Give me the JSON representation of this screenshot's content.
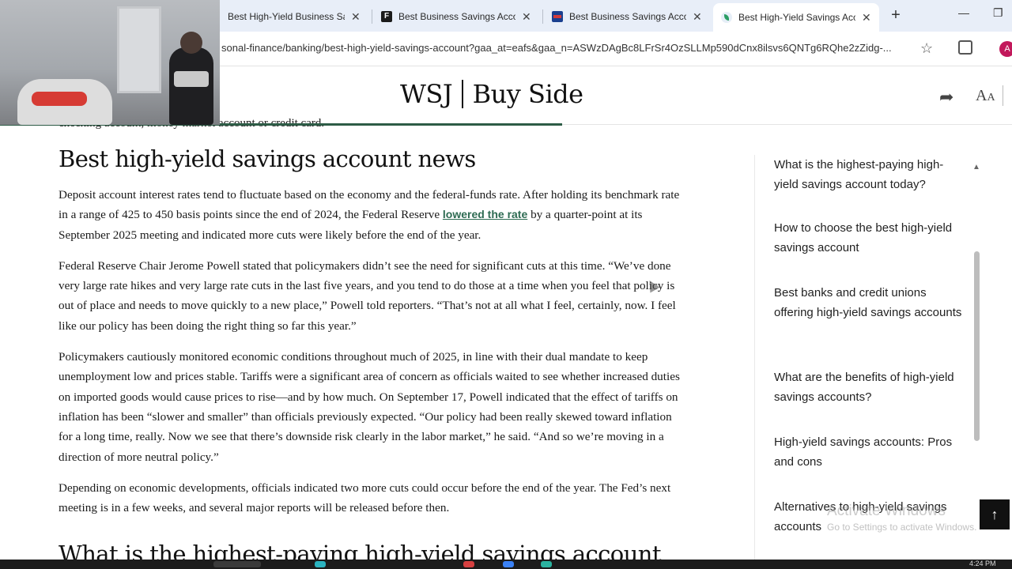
{
  "browser": {
    "tabs": [
      {
        "title": "Best High-Yield Business Sa",
        "favicon": "none",
        "active": false
      },
      {
        "title": "Best Business Savings Acco",
        "favicon": "forbes-f-icon",
        "active": false
      },
      {
        "title": "Best Business Savings Acco",
        "favicon": "usnews-icon",
        "active": false
      },
      {
        "title": "Best High-Yield Savings Acc",
        "favicon": "buyside-leaf-icon",
        "active": true
      }
    ],
    "close_glyph": "✕",
    "new_tab_glyph": "+",
    "url": "sonal-finance/banking/best-high-yield-savings-account?gaa_at=eafs&gaa_n=ASWzDAgBc8LFrSr4OzSLLMp590dCnx8ilsvs6QNTg6RQhe2zZidg-...",
    "profile_initial": "A"
  },
  "header": {
    "logo_left": "WSJ",
    "logo_right": "Buy Side"
  },
  "article": {
    "cutoff_text": "checking account, money market account or credit card.",
    "heading": "Best high-yield savings account news",
    "p1_a": "Deposit account interest rates tend to fluctuate based on the economy and the federal-funds rate.  After holding its benchmark rate in a range of 425 to 450 basis points since the end of 2024, the Federal Reserve ",
    "p1_link": "lowered the rate",
    "p1_b": " by a quarter-point at its September 2025 meeting and indicated more cuts were likely before the end of the year.",
    "p2": "Federal Reserve Chair Jerome Powell stated that policymakers didn’t see the need for significant cuts at this time. “We’ve done very large rate hikes and very large rate cuts in the last five years, and you tend to do those at a time when you feel that policy is out of place and needs to move quickly to a new place,” Powell told reporters. “That’s not at all what I feel, certainly, now. I feel like our policy has been doing the right thing so far this year.”",
    "p3": "Policymakers cautiously monitored economic conditions throughout much of 2025, in line with their dual mandate to keep unemployment low and prices stable. Tariffs were a significant area of concern as officials waited to see whether increased duties on imported goods would cause prices to rise—and by how much. On September 17, Powell indicated that the effect of tariffs on inflation has been “slower and smaller” than officials previously expected. “Our policy had been really skewed toward inflation for a long time, really. Now we see that there’s downside risk clearly in the labor market,” he said. “And so we’re moving in a direction of more neutral policy.”",
    "p4": "Depending on economic developments, officials indicated two more cuts could occur before the end of the year. The Fed’s next meeting is in a few weeks, and several major reports will be released before then.",
    "next_heading": "What is the highest-paying high-yield savings account"
  },
  "toc": {
    "items": [
      "What is the highest-paying high-yield savings account today?",
      "How to choose the best high-yield savings account",
      "Best banks and credit unions offering high-yield savings accounts",
      "What are the benefits of high-yield savings accounts?",
      "High-yield savings accounts: Pros and cons",
      "Alternatives to high-yield savings accounts"
    ]
  },
  "overlay": {
    "watermark_title": "Activate Windows",
    "watermark_sub": "Go to Settings to activate Windows.",
    "clock": "4:24 PM"
  },
  "colors": {
    "accent_green": "#2d5c46",
    "link_green": "#2d6b52",
    "tabbar_bg": "#e8eef8"
  }
}
